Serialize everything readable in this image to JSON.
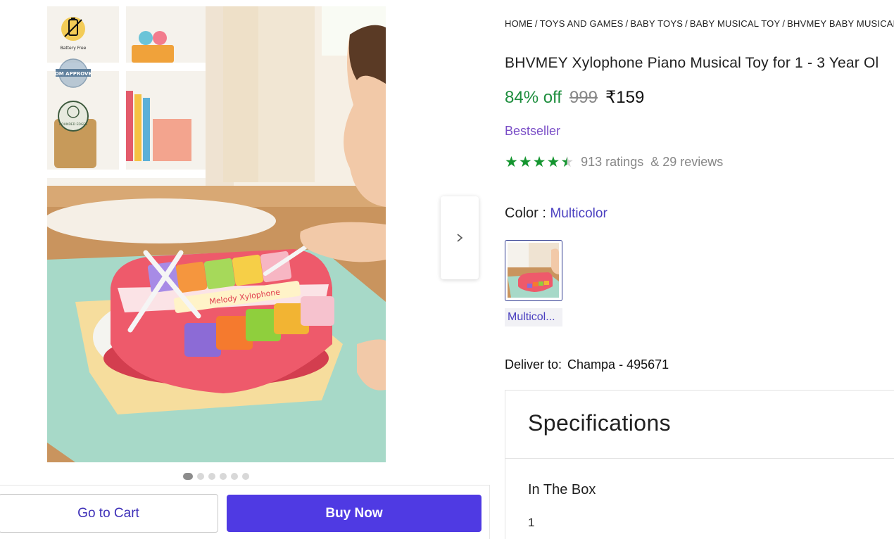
{
  "gallery": {
    "image_alt": "Child playing with a pink Melody Xylophone piano toy on a play mat",
    "toy_label": "Melody Xylophone",
    "badges": [
      {
        "icon": "battery-free-icon",
        "caption": "Battery Free"
      },
      {
        "icon": "hom-approved-icon",
        "caption": "HOM APPROVED"
      },
      {
        "icon": "rounded-edges-icon",
        "caption": "ROUNDED EDGES"
      }
    ],
    "dots_total": 6,
    "active_dot": 0
  },
  "actions": {
    "cart_label": "Go to Cart",
    "buy_label": "Buy Now"
  },
  "breadcrumb": {
    "items": [
      "HOME",
      "TOYS AND GAMES",
      "BABY TOYS",
      "BABY MUSICAL TOY",
      "BHVMEY BABY MUSICAL"
    ],
    "separator": "/"
  },
  "product": {
    "title": "BHVMEY Xylophone Piano Musical Toy for 1 - 3 Year Ol",
    "discount": "84% off",
    "mrp": "999",
    "price": "₹159",
    "tag": "Bestseller",
    "rating_value": 4.5,
    "ratings_text": "913 ratings",
    "reviews_text": "& 29 reviews",
    "color_label": "Color :",
    "color_value": "Multicolor",
    "swatch_label": "Multicol..."
  },
  "delivery": {
    "label": "Deliver to:",
    "location": "Champa - 495671"
  },
  "specifications": {
    "heading": "Specifications",
    "rows": [
      {
        "label": "In The Box",
        "value": "1"
      }
    ]
  },
  "colors": {
    "accent": "#4f3ae3",
    "discount": "#1e8e3e",
    "bestseller": "#7a4ec7",
    "star": "#14952f"
  }
}
